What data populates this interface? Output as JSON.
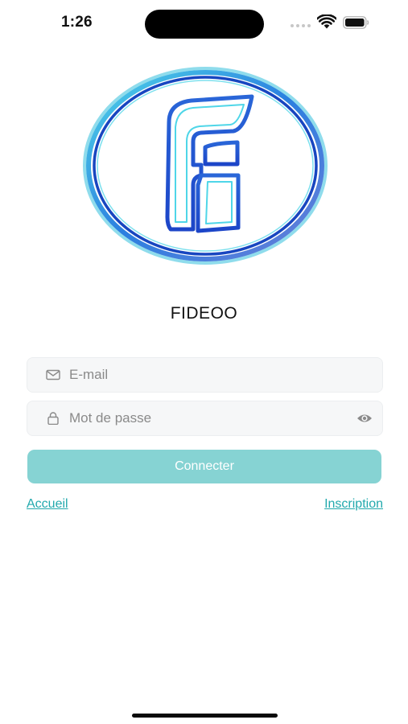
{
  "status_bar": {
    "time": "1:26",
    "icons": [
      "cellular-signal-icon",
      "wifi-icon",
      "battery-icon"
    ]
  },
  "logo": {
    "icon": "fideoo-logo-icon",
    "colors": {
      "ring_outer": "#3a9be0",
      "ring_inner": "#1a4ed0",
      "accent": "#4fd6e8"
    }
  },
  "app": {
    "name": "FIDEOO"
  },
  "form": {
    "email": {
      "placeholder": "E-mail",
      "value": "",
      "icon": "mail-icon"
    },
    "password": {
      "placeholder": "Mot de passe",
      "value": "",
      "icon": "lock-icon",
      "toggle_icon": "eye-icon"
    },
    "submit_label": "Connecter"
  },
  "links": {
    "home": "Accueil",
    "signup": "Inscription"
  },
  "colors": {
    "primary": "#86d3d3",
    "link": "#22a9ad",
    "field_bg": "#f6f7f8"
  }
}
